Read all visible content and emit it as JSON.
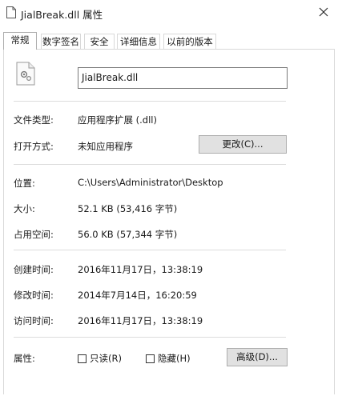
{
  "window": {
    "title": "JialBreak.dll 属性"
  },
  "icons": {
    "title_icon": "file-icon",
    "close": "close-icon",
    "file_large": "dll-file-icon"
  },
  "tabs": [
    {
      "label": "常规",
      "active": true
    },
    {
      "label": "数字签名",
      "active": false
    },
    {
      "label": "安全",
      "active": false
    },
    {
      "label": "详细信息",
      "active": false
    },
    {
      "label": "以前的版本",
      "active": false
    }
  ],
  "general": {
    "file_name": "JialBreak.dll",
    "type_label": "文件类型:",
    "type_value": "应用程序扩展 (.dll)",
    "open_with_label": "打开方式:",
    "open_with_value": "未知应用程序",
    "change_button": "更改(C)...",
    "location_label": "位置:",
    "location_value": "C:\\Users\\Administrator\\Desktop",
    "size_label": "大小:",
    "size_value": "52.1 KB (53,416 字节)",
    "size_on_disk_label": "占用空间:",
    "size_on_disk_value": "56.0 KB (57,344 字节)",
    "created_label": "创建时间:",
    "created_value": "2016年11月17日，13:38:19",
    "modified_label": "修改时间:",
    "modified_value": "2014年7月14日，16:20:59",
    "accessed_label": "访问时间:",
    "accessed_value": "2016年11月17日，13:38:19",
    "attributes_label": "属性:",
    "readonly_label": "只读(R)",
    "readonly_checked": false,
    "hidden_label": "隐藏(H)",
    "hidden_checked": false,
    "advanced_button": "高级(D)..."
  }
}
